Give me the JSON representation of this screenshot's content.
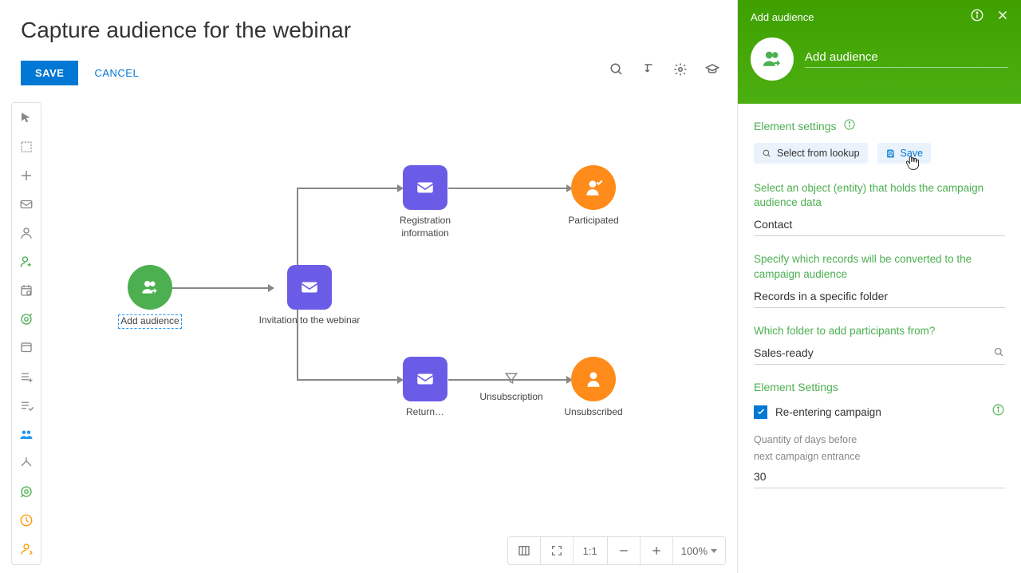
{
  "page": {
    "title": "Capture audience for the webinar"
  },
  "toolbar": {
    "save": "SAVE",
    "cancel": "CANCEL"
  },
  "canvas": {
    "nodes": {
      "add_audience": "Add audience",
      "invitation": "Invitation to the webinar",
      "registration": "Registration information",
      "participated": "Participated",
      "return": "Return…",
      "unsubscription": "Unsubscription",
      "unsubscribed": "Unsubscribed"
    }
  },
  "bottom": {
    "ratio": "1:1",
    "zoom": "100%"
  },
  "panel": {
    "header_title": "Add audience",
    "element_name": "Add audience",
    "section_element_settings": "Element settings",
    "pill_lookup": "Select from lookup",
    "pill_save": "Save",
    "label_object": "Select an object (entity) that holds the campaign audience data",
    "value_object": "Contact",
    "label_records": "Specify which records will be converted to the campaign audience",
    "value_records": "Records in a specific folder",
    "label_folder": "Which folder to add participants from?",
    "value_folder": "Sales-ready",
    "section_settings2": "Element Settings",
    "checkbox_label": "Re-entering campaign",
    "days_label_1": "Quantity of days before",
    "days_label_2": "next campaign entrance",
    "days_value": "30"
  }
}
